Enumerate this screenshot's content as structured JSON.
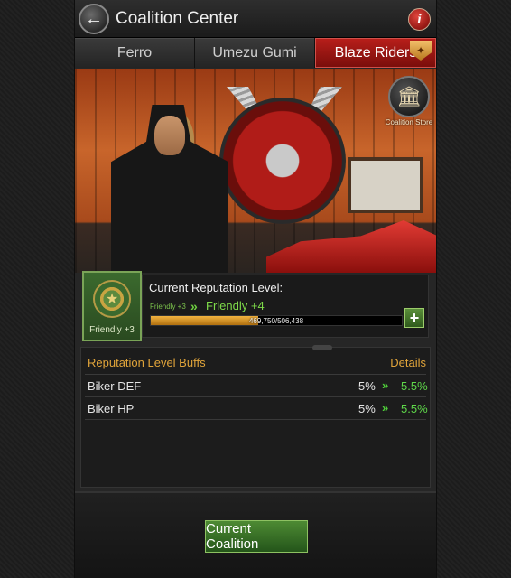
{
  "header": {
    "title": "Coalition Center",
    "back_icon": "back-arrow-icon",
    "info_label": "i"
  },
  "tabs": [
    {
      "label": "Ferro",
      "active": false
    },
    {
      "label": "Umezu Gumi",
      "active": false
    },
    {
      "label": "Blaze Riders",
      "active": true
    }
  ],
  "scene": {
    "store_label": "Coalition Store"
  },
  "reputation": {
    "title": "Current Reputation Level:",
    "badge_label": "Friendly +3",
    "from_label": "Friendly +3",
    "to_label": "Friendly +4",
    "progress_text": "469,750/506,438",
    "progress_current": 469750,
    "progress_max": 506438
  },
  "buffs": {
    "title": "Reputation Level Buffs",
    "details_label": "Details",
    "rows": [
      {
        "name": "Biker DEF",
        "current": "5%",
        "next": "5.5%"
      },
      {
        "name": "Biker HP",
        "current": "5%",
        "next": "5.5%"
      }
    ]
  },
  "footer": {
    "button_label": "Current Coalition"
  },
  "colors": {
    "accent_red": "#b71e1a",
    "accent_green": "#4d8a33",
    "gold": "#e0a43a"
  }
}
